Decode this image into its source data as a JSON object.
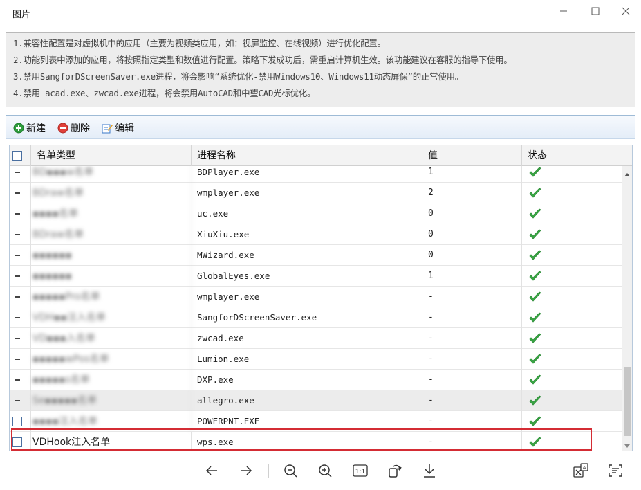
{
  "window": {
    "title": "图片",
    "minimize_icon": "minimize-icon",
    "maximize_icon": "maximize-icon",
    "close_icon": "close-icon"
  },
  "notice": {
    "lines": [
      "1.兼容性配置是对虚拟机中的应用（主要为视频类应用，如：视屏监控、在线视频）进行优化配置。",
      "2.功能列表中添加的应用，将按照指定类型和数值进行配置。策略下发成功后，需重启计算机生效。该功能建议在客服的指导下使用。",
      "3.禁用SangforDScreenSaver.exe进程，将会影响“系统优化-禁用Windows10、Windows11动态屏保”的正常使用。",
      "4.禁用 acad.exe、zwcad.exe进程，将会禁用AutoCAD和中望CAD光标优化。"
    ]
  },
  "toolbar": {
    "new_label": "新建",
    "delete_label": "删除",
    "edit_label": "编辑",
    "colors": {
      "new": "#2e9e3e",
      "delete": "#e0403a",
      "edit": "#3a78c8"
    }
  },
  "table": {
    "columns": [
      "名单类型",
      "进程名称",
      "值",
      "状态"
    ],
    "rows": [
      {
        "type": "BD▪▪▪w名单",
        "process": "BDPlayer.exe",
        "value": "1",
        "status": "check-icon",
        "marker": "dash",
        "obscured": true
      },
      {
        "type": "BDraw名单",
        "process": "wmplayer.exe",
        "value": "2",
        "status": "check-icon",
        "marker": "dash",
        "obscured": true
      },
      {
        "type": "▪▪▪▪名单",
        "process": "uc.exe",
        "value": "0",
        "status": "check-icon",
        "marker": "dash",
        "obscured": true
      },
      {
        "type": "BDraw名单",
        "process": "XiuXiu.exe",
        "value": "0",
        "status": "check-icon",
        "marker": "dash",
        "obscured": true
      },
      {
        "type": "▪▪▪▪▪▪",
        "process": "MWizard.exe",
        "value": "0",
        "status": "check-icon",
        "marker": "dash",
        "obscured": true
      },
      {
        "type": "▪▪▪▪▪▪",
        "process": "GlobalEyes.exe",
        "value": "1",
        "status": "check-icon",
        "marker": "dash",
        "obscured": true
      },
      {
        "type": "▪▪▪▪▪Pro名单",
        "process": "wmplayer.exe",
        "value": "-",
        "status": "check-icon",
        "marker": "dash",
        "obscured": true
      },
      {
        "type": "VDH▪▪注入名单",
        "process": "SangforDScreenSaver.exe",
        "value": "-",
        "status": "check-icon",
        "marker": "dash",
        "obscured": true
      },
      {
        "type": "VD▪▪▪入名单",
        "process": "zwcad.exe",
        "value": "-",
        "status": "check-icon",
        "marker": "dash",
        "obscured": true
      },
      {
        "type": "▪▪▪▪▪wPos名单",
        "process": "Lumion.exe",
        "value": "-",
        "status": "check-icon",
        "marker": "dash",
        "obscured": true
      },
      {
        "type": "▪▪▪▪▪s名单",
        "process": "DXP.exe",
        "value": "-",
        "status": "check-icon",
        "marker": "dash",
        "obscured": true
      },
      {
        "type": "Se▪▪▪▪▪名单",
        "process": "allegro.exe",
        "value": "-",
        "status": "check-icon",
        "marker": "dash",
        "obscured": true,
        "selected": true
      },
      {
        "type": "▪▪▪▪注入名单",
        "process": "POWERPNT.EXE",
        "value": "-",
        "status": "check-icon",
        "marker": "checkbox",
        "obscured": true
      },
      {
        "type": "VDHook注入名单",
        "process": "wps.exe",
        "value": "-",
        "status": "check-icon",
        "marker": "checkbox",
        "obscured": false
      }
    ]
  },
  "viewer_toolbar": {
    "buttons": [
      "back-arrow-icon",
      "forward-arrow-icon",
      "zoom-out-icon",
      "zoom-in-icon",
      "actual-size-icon",
      "rotate-icon",
      "download-icon",
      "translate-icon",
      "text-recognition-icon"
    ],
    "actual_size_label": "1:1",
    "translate_badge": "A"
  }
}
